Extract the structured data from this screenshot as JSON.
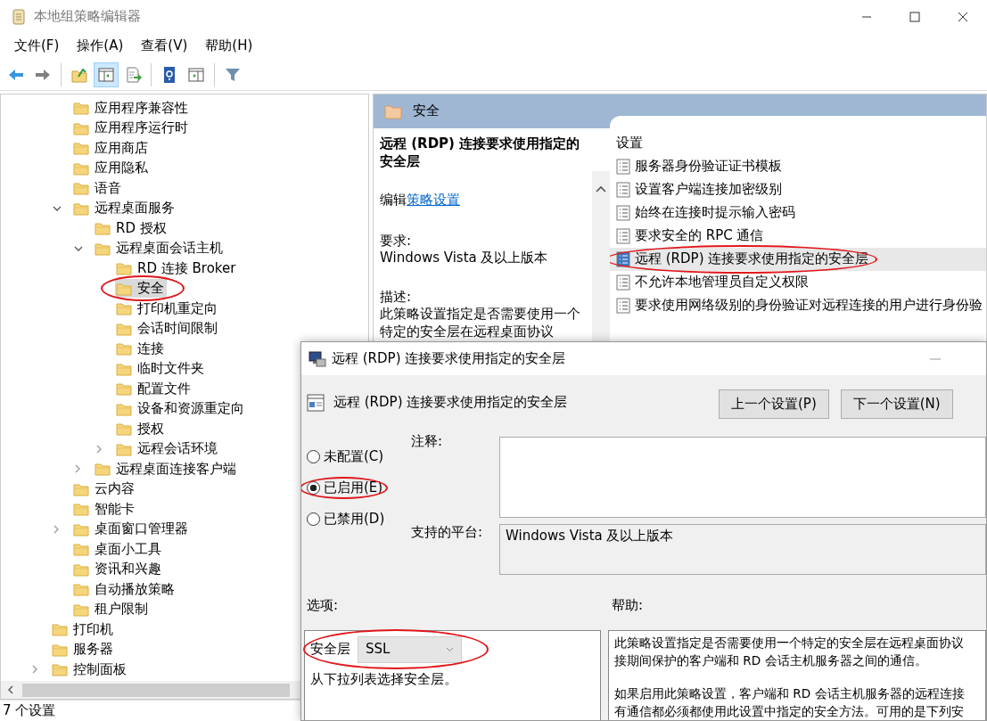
{
  "window": {
    "title": "本地组策略编辑器"
  },
  "menu": [
    {
      "label": "文件(F)"
    },
    {
      "label": "操作(A)"
    },
    {
      "label": "查看(V)"
    },
    {
      "label": "帮助(H)"
    }
  ],
  "toolbar": [
    {
      "kind": "button",
      "pressed": false
    },
    {
      "kind": "button",
      "pressed": false
    },
    {
      "kind": "separator"
    },
    {
      "kind": "button",
      "pressed": false
    },
    {
      "kind": "button",
      "pressed": true
    },
    {
      "kind": "button",
      "pressed": false
    },
    {
      "kind": "separator"
    },
    {
      "kind": "button",
      "pressed": false
    },
    {
      "kind": "button",
      "pressed": false
    },
    {
      "kind": "separator"
    },
    {
      "kind": "button",
      "pressed": false
    }
  ],
  "tree": [
    {
      "children": [
        {
          "label": "应用程序兼容性",
          "selected": false,
          "circled": false
        },
        {
          "label": "应用程序运行时",
          "selected": false,
          "circled": false
        },
        {
          "label": "应用商店",
          "selected": false,
          "circled": false
        },
        {
          "label": "应用隐私",
          "selected": false,
          "circled": false
        },
        {
          "label": "语音",
          "selected": false,
          "circled": false
        },
        {
          "label": "远程桌面服务",
          "selected": false,
          "circled": false,
          "expanded": true,
          "children": [
            {
              "label": "RD 授权",
              "selected": false,
              "circled": false
            },
            {
              "label": "远程桌面会话主机",
              "selected": false,
              "circled": false,
              "expanded": true,
              "children": [
                {
                  "label": "RD 连接 Broker",
                  "selected": false,
                  "circled": false
                },
                {
                  "label": "安全",
                  "selected": true,
                  "circled": true
                },
                {
                  "label": "打印机重定向",
                  "selected": false,
                  "circled": false
                },
                {
                  "label": "会话时间限制",
                  "selected": false,
                  "circled": false
                },
                {
                  "label": "连接",
                  "selected": false,
                  "circled": false
                },
                {
                  "label": "临时文件夹",
                  "selected": false,
                  "circled": false
                },
                {
                  "label": "配置文件",
                  "selected": false,
                  "circled": false
                },
                {
                  "label": "设备和资源重定向",
                  "selected": false,
                  "circled": false
                },
                {
                  "label": "授权",
                  "selected": false,
                  "circled": false
                },
                {
                  "label": "远程会话环境",
                  "selected": false,
                  "circled": false,
                  "expanded": false
                }
              ]
            },
            {
              "label": "远程桌面连接客户端",
              "selected": false,
              "circled": false,
              "expanded": false
            }
          ]
        },
        {
          "label": "云内容",
          "selected": false,
          "circled": false
        },
        {
          "label": "智能卡",
          "selected": false,
          "circled": false
        },
        {
          "label": "桌面窗口管理器",
          "selected": false,
          "circled": false,
          "expanded": false
        },
        {
          "label": "桌面小工具",
          "selected": false,
          "circled": false
        },
        {
          "label": "资讯和兴趣",
          "selected": false,
          "circled": false
        },
        {
          "label": "自动播放策略",
          "selected": false,
          "circled": false
        },
        {
          "label": "租户限制",
          "selected": false,
          "circled": false
        }
      ]
    },
    {
      "label": "打印机",
      "selected": false,
      "circled": false
    },
    {
      "label": "服务器",
      "selected": false,
      "circled": false
    },
    {
      "label": "控制面板",
      "selected": false,
      "circled": false,
      "expanded": false
    }
  ],
  "pane_header": {
    "title": "安全"
  },
  "description": {
    "title": "远程 (RDP) 连接要求使用指定的安全层",
    "edit_prefix": "编辑",
    "edit_link": "策略设置",
    "requirements_label": "要求:",
    "requirements": "Windows Vista 及以上版本",
    "description_label": "描述:",
    "description": "此策略设置指定是否需要使用一个特定的安全层在远程桌面协议"
  },
  "settings": {
    "column": "设置",
    "items": [
      {
        "label": "服务器身份验证证书模板",
        "selected": false,
        "circled": false
      },
      {
        "label": "设置客户端连接加密级别",
        "selected": false,
        "circled": false
      },
      {
        "label": "始终在连接时提示输入密码",
        "selected": false,
        "circled": false
      },
      {
        "label": "要求安全的 RPC 通信",
        "selected": false,
        "circled": false
      },
      {
        "label": "远程 (RDP) 连接要求使用指定的安全层",
        "selected": true,
        "circled": true
      },
      {
        "label": "不允许本地管理员自定义权限",
        "selected": false,
        "circled": false
      },
      {
        "label": "要求使用网络级别的身份验证对远程连接的用户进行身份验",
        "selected": false,
        "circled": false
      }
    ]
  },
  "status_bar": "7 个设置",
  "dialog": {
    "title": "远程 (RDP) 连接要求使用指定的安全层",
    "heading": "远程 (RDP) 连接要求使用指定的安全层",
    "buttons": [
      "上一个设置(P)",
      "下一个设置(N)"
    ],
    "states": [
      {
        "label": "未配置(C)",
        "selected": false,
        "circled": false
      },
      {
        "label": "已启用(E)",
        "selected": true,
        "circled": true
      },
      {
        "label": "已禁用(D)",
        "selected": false,
        "circled": false
      }
    ],
    "comment_label": "注释:",
    "platform_label": "支持的平台:",
    "platform": "Windows Vista 及以上版本",
    "options_label": "选项:",
    "help_label": "帮助:",
    "options": [
      {
        "label": "安全层",
        "value": "SSL",
        "circled": true
      }
    ],
    "options_hint": "从下拉列表选择安全层。",
    "help": [
      [
        "此策略设置指定是否需要使用一个特定的安全层在远程桌面协议",
        "接期间保护的客户端和 RD 会话主机服务器之间的通信。"
      ],
      [
        "如果启用此策略设置，客户端和 RD 会话主机服务器的远程连接",
        "有通信都必须都使用此设置中指定的安全方法。可用的是下列安"
      ]
    ]
  }
}
